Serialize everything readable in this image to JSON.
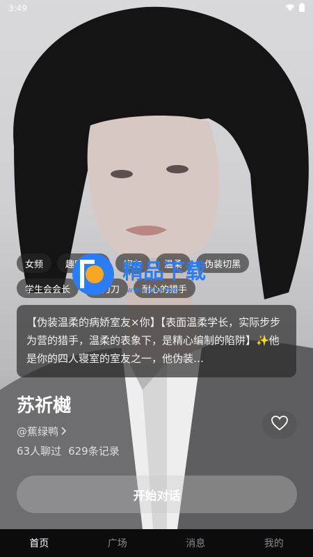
{
  "status_bar": {
    "time": "3:49"
  },
  "tags": {
    "row1": [
      "女频",
      "趣味恋爱",
      "室友",
      "温柔",
      "伪装切黑"
    ],
    "row2": [
      "学生会会长",
      "刀刀刀",
      "耐心的猎手"
    ]
  },
  "watermark": {
    "brand": "精品下载",
    "url": "www.jpxz.net"
  },
  "description": "【伪装温柔的病娇室友×你】【表面温柔学长，实际步步为营的猎手，温柔的表象下，是精心编制的陷阱】✨他是你的四人寝室的室友之一，他伪装…",
  "character": {
    "name": "苏祈樾",
    "author": "@蕉绿鸭",
    "chat_count": "63人聊过",
    "record_count": "629条记录"
  },
  "start_button": "开始对话",
  "nav": {
    "items": [
      "首页",
      "广场",
      "消息",
      "我的"
    ],
    "active_index": 0
  },
  "colors": {
    "nav_bg": "#0c0c0c",
    "card_bg": "#2a2a2a",
    "text": "#ffffff",
    "muted": "#8a8a8a"
  },
  "icons": {
    "wifi": "wifi-icon",
    "battery": "battery-icon",
    "chevron": "chevron-right-icon",
    "heart": "heart-icon"
  }
}
